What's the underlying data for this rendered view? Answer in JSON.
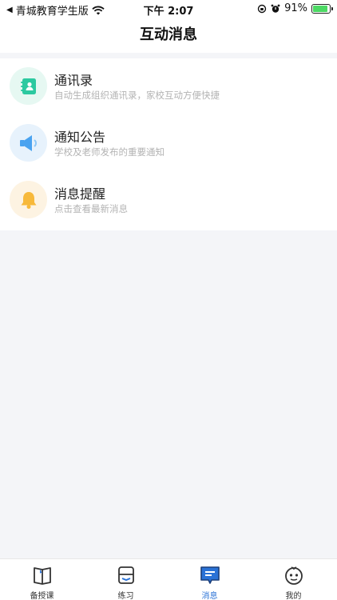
{
  "status_bar": {
    "back_app": "青城教育学生版",
    "time": "下午 2:07",
    "battery": "91%"
  },
  "nav": {
    "title": "互动消息"
  },
  "items": [
    {
      "title": "通讯录",
      "subtitle": "自动生成组织通讯录，家校互动方便快捷",
      "icon": "contacts-book-icon",
      "color": "#2cc9a0",
      "bg": "#e6f8f2"
    },
    {
      "title": "通知公告",
      "subtitle": "学校及老师发布的重要通知",
      "icon": "speaker-icon",
      "color": "#4aa3f0",
      "bg": "#e7f2fc"
    },
    {
      "title": "消息提醒",
      "subtitle": "点击查看最新消息",
      "icon": "bell-icon",
      "color": "#f7b93b",
      "bg": "#fdf3e2"
    }
  ],
  "tabs": [
    {
      "label": "备授课",
      "icon": "book-icon"
    },
    {
      "label": "练习",
      "icon": "practice-icon"
    },
    {
      "label": "消息",
      "icon": "message-icon",
      "active": true
    },
    {
      "label": "我的",
      "icon": "profile-face-icon"
    }
  ],
  "colors": {
    "accent": "#2a72d6",
    "background": "#f4f5f8"
  }
}
